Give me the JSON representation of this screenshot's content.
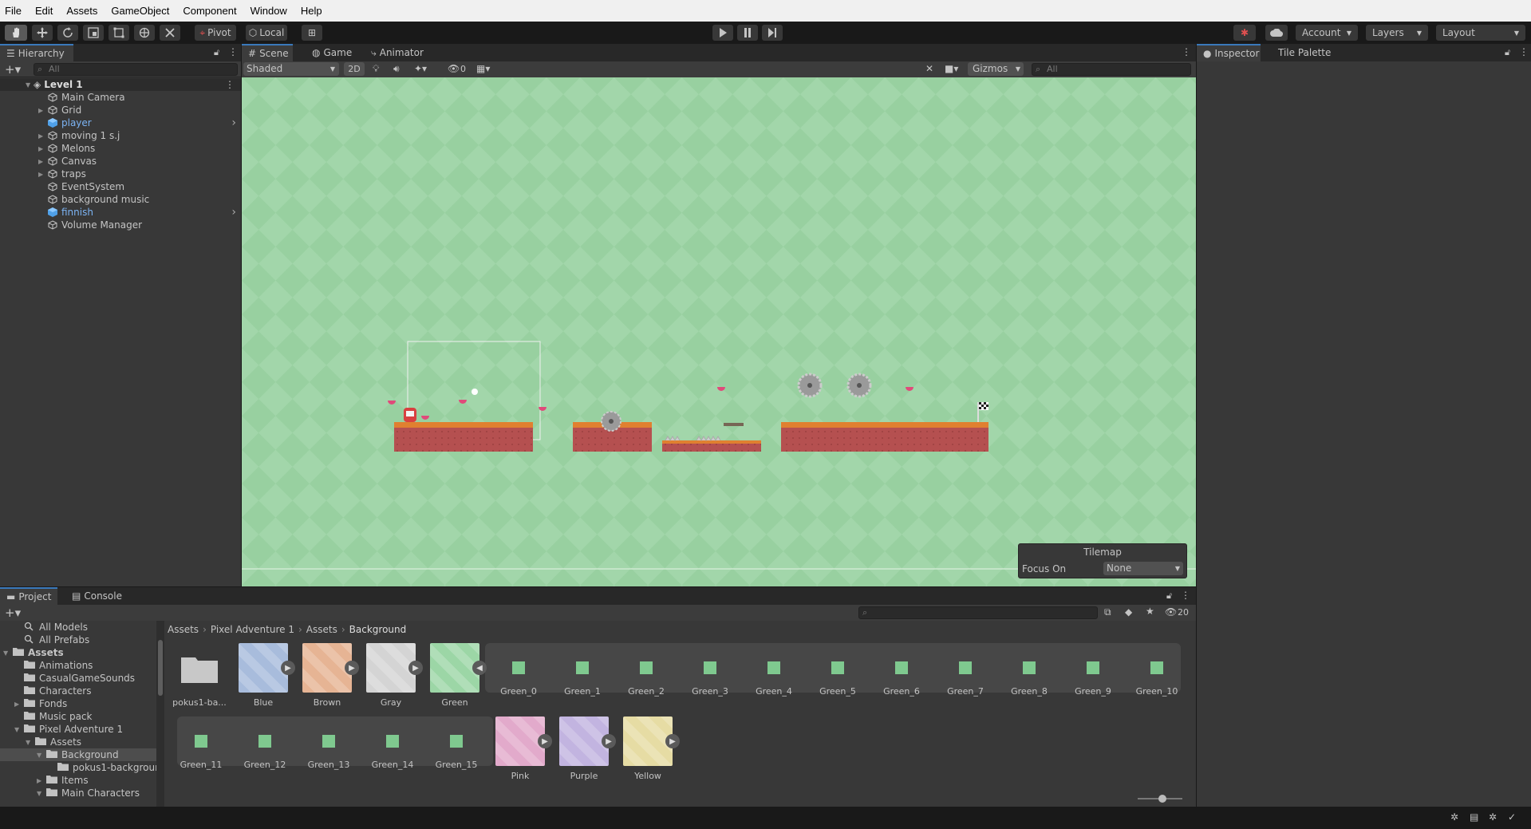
{
  "menu": [
    "File",
    "Edit",
    "Assets",
    "GameObject",
    "Component",
    "Window",
    "Help"
  ],
  "toolbar": {
    "pivot": "Pivot",
    "local": "Local",
    "account": "Account",
    "layers": "Layers",
    "layout": "Layout"
  },
  "hierarchy": {
    "tab": "Hierarchy",
    "search_placeholder": "All",
    "scene": "Level 1",
    "items": [
      {
        "label": "Main Camera",
        "color": "#c4c4c4",
        "icon": "cube-outline-icon"
      },
      {
        "label": "Grid",
        "color": "#c4c4c4",
        "icon": "cube-outline-icon"
      },
      {
        "label": "player",
        "color": "#7cb4f4",
        "icon": "prefab-cube-icon"
      },
      {
        "label": "moving 1 s.j",
        "color": "#c4c4c4",
        "icon": "cube-outline-icon"
      },
      {
        "label": "Melons",
        "color": "#c4c4c4",
        "icon": "cube-outline-icon"
      },
      {
        "label": "Canvas",
        "color": "#c4c4c4",
        "icon": "cube-outline-icon"
      },
      {
        "label": "traps",
        "color": "#c4c4c4",
        "icon": "cube-outline-icon"
      },
      {
        "label": "EventSystem",
        "color": "#c4c4c4",
        "icon": "cube-outline-icon"
      },
      {
        "label": "background music",
        "color": "#c4c4c4",
        "icon": "cube-outline-icon"
      },
      {
        "label": "finnish",
        "color": "#7cb4f4",
        "icon": "prefab-cube-icon"
      },
      {
        "label": "Volume Manager",
        "color": "#c4c4c4",
        "icon": "cube-outline-icon"
      }
    ]
  },
  "scene_view": {
    "tabs": [
      "Scene",
      "Game",
      "Animator"
    ],
    "shading": "Shaded",
    "mode_2d": "2D",
    "hidden_count": "0",
    "gizmos": "Gizmos",
    "search_placeholder": "All",
    "tilemap_overlay": {
      "title": "Tilemap",
      "focus_label": "Focus On",
      "focus_value": "None"
    }
  },
  "inspector": {
    "tabs": [
      "Inspector",
      "Tile Palette"
    ]
  },
  "project": {
    "tabs": [
      "Project",
      "Console"
    ],
    "hidden_count": "20",
    "breadcrumb": [
      "Assets",
      "Pixel Adventure 1",
      "Assets",
      "Background"
    ],
    "tree": [
      {
        "label": "All Models",
        "indent": 1,
        "icon": "search-icon"
      },
      {
        "label": "All Prefabs",
        "indent": 1,
        "icon": "search-icon"
      },
      {
        "label": "Assets",
        "indent": 0,
        "icon": "folder-icon",
        "bold": true
      },
      {
        "label": "Animations",
        "indent": 1,
        "icon": "folder-icon"
      },
      {
        "label": "CasualGameSounds",
        "indent": 1,
        "icon": "folder-icon"
      },
      {
        "label": "Characters",
        "indent": 1,
        "icon": "folder-icon"
      },
      {
        "label": "Fonds",
        "indent": 1,
        "icon": "folder-icon"
      },
      {
        "label": "Music pack",
        "indent": 1,
        "icon": "folder-icon"
      },
      {
        "label": "Pixel Adventure 1",
        "indent": 1,
        "icon": "folder-icon"
      },
      {
        "label": "Assets",
        "indent": 2,
        "icon": "folder-icon"
      },
      {
        "label": "Background",
        "indent": 3,
        "icon": "folder-icon",
        "selected": true
      },
      {
        "label": "pokus1-backgrour",
        "indent": 4,
        "icon": "folder-icon"
      },
      {
        "label": "Items",
        "indent": 3,
        "icon": "folder-icon"
      },
      {
        "label": "Main Characters",
        "indent": 3,
        "icon": "folder-icon"
      }
    ],
    "assets_row1": [
      {
        "label": "pokus1-ba...",
        "kind": "folder"
      },
      {
        "label": "Blue",
        "kind": "tex",
        "color": "#a8bcdc"
      },
      {
        "label": "Brown",
        "kind": "tex",
        "color": "#e6b494"
      },
      {
        "label": "Gray",
        "kind": "tex",
        "color": "#d4d4d4"
      },
      {
        "label": "Green",
        "kind": "tex",
        "color": "#9cd6a6"
      }
    ],
    "sprites_row1": [
      "Green_0",
      "Green_1",
      "Green_2",
      "Green_3",
      "Green_4",
      "Green_5",
      "Green_6",
      "Green_7",
      "Green_8",
      "Green_9",
      "Green_10"
    ],
    "sprites_row2": [
      "Green_11",
      "Green_12",
      "Green_13",
      "Green_14",
      "Green_15"
    ],
    "assets_row2": [
      {
        "label": "Pink",
        "color": "#e2aacb"
      },
      {
        "label": "Purple",
        "color": "#c2b4e0"
      },
      {
        "label": "Yellow",
        "color": "#e6dca4"
      }
    ]
  }
}
